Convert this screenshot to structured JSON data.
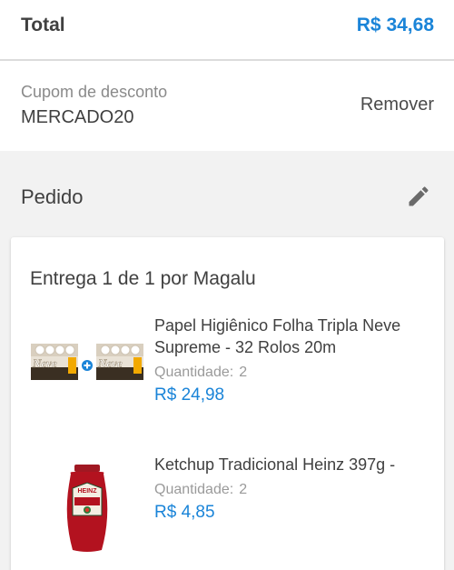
{
  "summary": {
    "total_label": "Total",
    "total_value": "R$ 34,68"
  },
  "coupon": {
    "label": "Cupom de desconto",
    "code": "MERCADO20",
    "remove_label": "Remover"
  },
  "order": {
    "title": "Pedido",
    "edit_icon": "pencil-icon",
    "delivery_title": "Entrega 1 de 1 por Magalu",
    "quantity_label": "Quantidade:",
    "items": [
      {
        "name": "Papel Higiênico Folha Tripla Neve Supreme - 32 Rolos 20m",
        "quantity": "2",
        "price": "R$ 24,98",
        "image_icon": "toilet-paper-pack-image",
        "brand_text": "Neve"
      },
      {
        "name": "Ketchup Tradicional Heinz 397g -",
        "quantity": "2",
        "price": "R$ 4,85",
        "image_icon": "ketchup-bottle-image",
        "brand_text": "HEINZ"
      }
    ]
  },
  "colors": {
    "accent": "#1a84d8",
    "text": "#404040",
    "muted": "#9a9a9a",
    "background": "#f2f2f2"
  }
}
